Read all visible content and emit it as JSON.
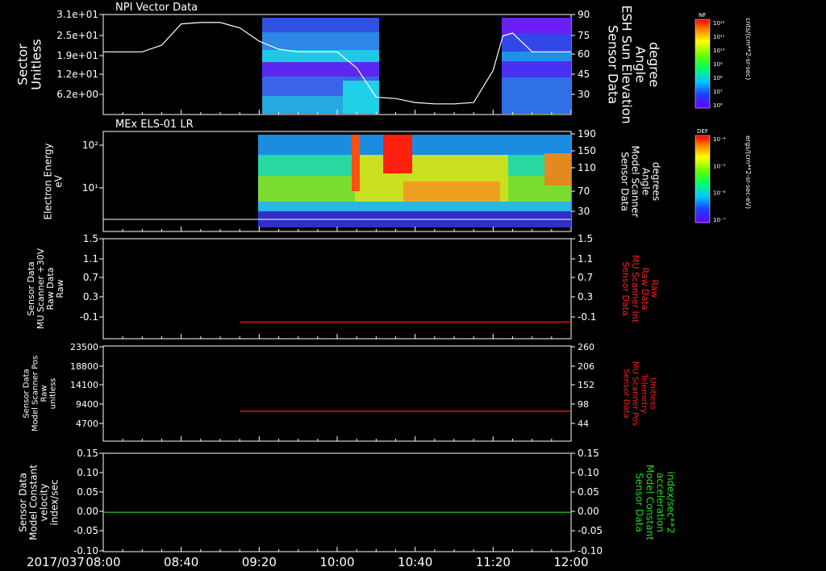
{
  "chart_data": [
    {
      "type": "heatmap",
      "title": "NPI Vector Data",
      "ylabel_left": [
        "Sector",
        "Unitless"
      ],
      "yticks_left": [
        "3.1e+01",
        "2.5e+01",
        "1.9e+01",
        "1.2e+01",
        "6.2e+00"
      ],
      "ylabel_right": [
        "Sensor Data",
        "ESH Sun Elevation",
        "Angle",
        "degree"
      ],
      "yticks_right": [
        "90",
        "75",
        "60",
        "45",
        "30"
      ],
      "colorbar": {
        "label": "NF",
        "unit": "cnts/(cm**2-sr-sec)",
        "ticks": [
          "10¹²",
          "10¹¹",
          "10¹⁰",
          "10⁹",
          "10⁸",
          "10⁷",
          "10⁶"
        ]
      },
      "series": [
        {
          "name": "ESH Sun Elevation Angle",
          "color": "#ffffff",
          "time": [
            "08:00",
            "08:10",
            "08:20",
            "08:30",
            "08:40",
            "08:50",
            "09:00",
            "09:10",
            "09:20",
            "09:30",
            "09:40",
            "09:50",
            "10:00",
            "10:10",
            "10:20",
            "10:30",
            "10:40",
            "10:50",
            "11:00",
            "11:10",
            "11:20",
            "11:25",
            "11:30",
            "11:40",
            "11:50",
            "12:00"
          ],
          "values": [
            62,
            62,
            62,
            67,
            83,
            84,
            84,
            80,
            70,
            64,
            62,
            62,
            62,
            50,
            28,
            27,
            24,
            23,
            23,
            24,
            48,
            74,
            76,
            62,
            62,
            62
          ]
        }
      ],
      "data_coverage": [
        [
          "09:15",
          "10:15"
        ],
        [
          "11:18",
          "12:00"
        ]
      ]
    },
    {
      "type": "heatmap",
      "title": "MEx ELS-01 LR",
      "ylabel_left": [
        "Electron Energy",
        "eV"
      ],
      "yticks_left": [
        "10²",
        "10¹"
      ],
      "ylabel_right": [
        "Sensor Data",
        "Model Scanner",
        "Angle",
        "degrees"
      ],
      "yticks_right": [
        "190",
        "150",
        "110",
        "70",
        "30"
      ],
      "colorbar": {
        "label": "DEF",
        "unit": "ergs/(cm**2-sr-sec-eV)",
        "ticks": [
          "10⁻⁴",
          "10⁻⁵",
          "10⁻⁶",
          "10⁻⁷"
        ]
      },
      "data_coverage": [
        [
          "09:13",
          "12:00"
        ]
      ]
    },
    {
      "type": "line",
      "ylabel_left": [
        "Sensor Data",
        "MU Scanner +30V",
        "Raw Data",
        "Raw"
      ],
      "yticks_left": [
        "1.5",
        "1.1",
        "0.7",
        "0.3",
        "-0.1"
      ],
      "ylabel_right": [
        "Sensor Data",
        "MU Scanner Int",
        "Raw Data",
        "Raw"
      ],
      "yticks_right": [
        "1.5",
        "1.1",
        "0.7",
        "0.3",
        "-0.1"
      ],
      "series": [
        {
          "name": "MU Scanner Int",
          "color": "#ff2020",
          "x": [
            "09:10",
            "12:00"
          ],
          "y": [
            0.0,
            0.0
          ]
        }
      ]
    },
    {
      "type": "line",
      "ylabel_left": [
        "Sensor Data",
        "Model Scanner Pos",
        "Raw",
        "unitless"
      ],
      "yticks_left": [
        "23500",
        "18800",
        "14100",
        "9400",
        "4700"
      ],
      "ylabel_right": [
        "Sensor Data",
        "MU Scanner Pos",
        "Telemetry",
        "Unitless"
      ],
      "yticks_right": [
        "260",
        "206",
        "152",
        "98",
        "44"
      ],
      "series": [
        {
          "name": "MU Scanner Pos",
          "color": "#ff2020",
          "x": [
            "09:10",
            "12:00"
          ],
          "y": [
            85,
            85
          ]
        }
      ]
    },
    {
      "type": "line",
      "ylabel_left": [
        "Sensor Data",
        "Model Constant",
        "velocity",
        "index/sec"
      ],
      "yticks_left": [
        "0.15",
        "0.10",
        "0.05",
        "0.00",
        "-0.05",
        "-0.10"
      ],
      "ylabel_right": [
        "Sensor Data",
        "Model Constant",
        "acceleration",
        "index/sec**2"
      ],
      "yticks_right": [
        "0.15",
        "0.10",
        "0.05",
        "0.00",
        "-0.05",
        "-0.10"
      ],
      "series": [
        {
          "name": "Model Constant acceleration",
          "color": "#22dd22",
          "x": [
            "08:00",
            "12:00"
          ],
          "y": [
            0.0,
            0.0
          ]
        }
      ]
    }
  ],
  "time_axis": {
    "date": "2017/037",
    "ticks": [
      "08:00",
      "08:40",
      "09:20",
      "10:00",
      "10:40",
      "11:20",
      "12:00"
    ]
  },
  "colors": {
    "background": "#000000",
    "foreground": "#ffffff",
    "red_label": "#ff2020",
    "green_label": "#22dd22"
  }
}
